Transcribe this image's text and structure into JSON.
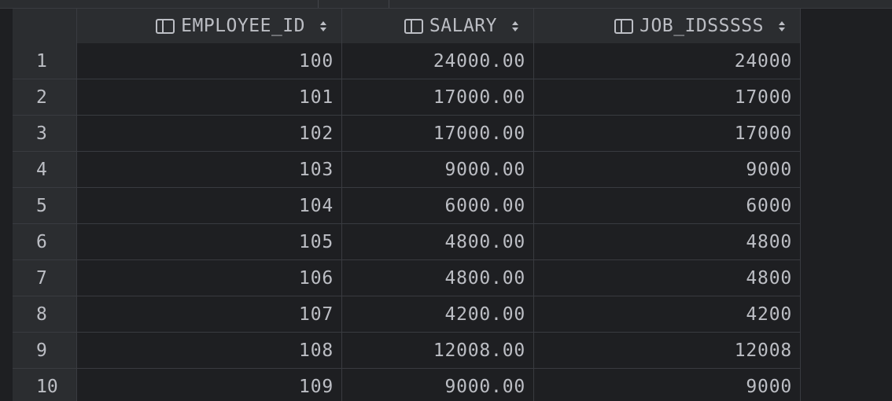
{
  "table": {
    "columns": [
      {
        "label": "EMPLOYEE_ID"
      },
      {
        "label": "SALARY"
      },
      {
        "label": "JOB_IDSSSSS"
      }
    ],
    "rows": [
      {
        "num": "1",
        "cells": [
          "100",
          "24000.00",
          "24000"
        ]
      },
      {
        "num": "2",
        "cells": [
          "101",
          "17000.00",
          "17000"
        ]
      },
      {
        "num": "3",
        "cells": [
          "102",
          "17000.00",
          "17000"
        ]
      },
      {
        "num": "4",
        "cells": [
          "103",
          "9000.00",
          "9000"
        ]
      },
      {
        "num": "5",
        "cells": [
          "104",
          "6000.00",
          "6000"
        ]
      },
      {
        "num": "6",
        "cells": [
          "105",
          "4800.00",
          "4800"
        ]
      },
      {
        "num": "7",
        "cells": [
          "106",
          "4800.00",
          "4800"
        ]
      },
      {
        "num": "8",
        "cells": [
          "107",
          "4200.00",
          "4200"
        ]
      },
      {
        "num": "9",
        "cells": [
          "108",
          "12008.00",
          "12008"
        ]
      },
      {
        "num": "10",
        "cells": [
          "109",
          "9000.00",
          "9000"
        ]
      }
    ]
  },
  "colors": {
    "background": "#1e1f22",
    "header_background": "#2b2d30",
    "grid_line": "#393b40",
    "text": "#bcbec4"
  },
  "icons": {
    "column_icon": "column-icon",
    "sort_icon": "sort-icon"
  }
}
